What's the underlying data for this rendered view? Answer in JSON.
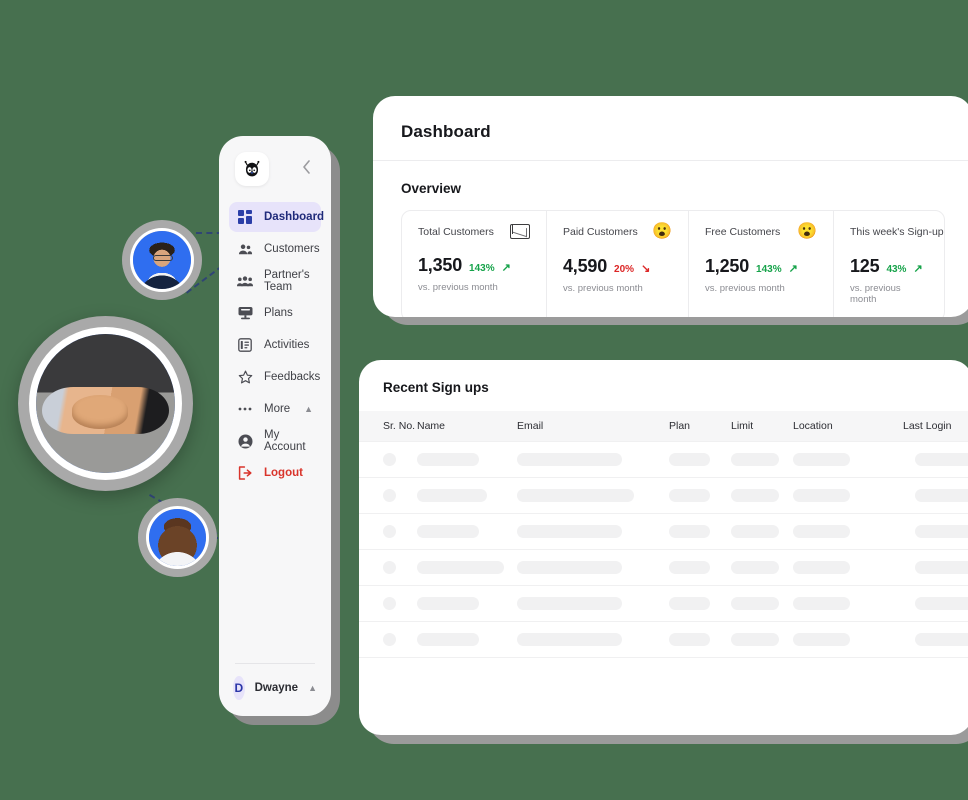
{
  "theme": {
    "background": "#47704f",
    "accent": "#2b3ea8",
    "active_bg": "#e7e3fa",
    "danger": "#d9342b",
    "up": "#16a34a",
    "down": "#dc2626"
  },
  "sidebar": {
    "logo_name": "penguin-mascot-logo",
    "collapse_icon": "chevron-left-icon",
    "items": [
      {
        "label": "Dashboard",
        "icon": "grid-dashboard-icon",
        "active": true
      },
      {
        "label": "Customers",
        "icon": "people-icon",
        "active": false
      },
      {
        "label": "Partner's Team",
        "icon": "group-team-icon",
        "active": false
      },
      {
        "label": "Plans",
        "icon": "monitor-icon",
        "active": false
      },
      {
        "label": "Activities",
        "icon": "list-panel-icon",
        "active": false
      },
      {
        "label": "Feedbacks",
        "icon": "star-icon",
        "active": false
      },
      {
        "label": "More",
        "icon": "ellipsis-icon",
        "active": false,
        "caret": "▲"
      },
      {
        "label": "My Account",
        "icon": "user-circle-icon",
        "active": false
      },
      {
        "label": "Logout",
        "icon": "logout-icon",
        "active": false,
        "danger": true
      }
    ],
    "user": {
      "initial": "D",
      "name": "Dwayne",
      "caret": "▲",
      "avatar_name": "user-avatar-initial"
    }
  },
  "main": {
    "page_title": "Dashboard",
    "overview_title": "Overview",
    "cards": [
      {
        "label": "Total Customers",
        "icon": "envelope-icon",
        "value": "1,350",
        "delta": "143%",
        "direction": "up",
        "arrow": "↗",
        "sub": "vs. previous month"
      },
      {
        "label": "Paid Customers",
        "icon": "astonished-face-emoji",
        "value": "4,590",
        "delta": "20%",
        "direction": "down",
        "arrow": "↘",
        "sub": "vs. previous month"
      },
      {
        "label": "Free Customers",
        "icon": "astonished-face-emoji",
        "value": "1,250",
        "delta": "143%",
        "direction": "up",
        "arrow": "↗",
        "sub": "vs. previous month"
      },
      {
        "label": "This week's Sign-up",
        "icon": "graduate-face-emoji",
        "value": "125",
        "delta": "43%",
        "direction": "up",
        "arrow": "↗",
        "sub": "vs. previous month"
      }
    ],
    "table": {
      "title": "Recent Sign ups",
      "columns": [
        "Sr. No.",
        "Name",
        "Email",
        "Plan",
        "Limit",
        "Location",
        "Last Login"
      ],
      "placeholder_row_count": 6,
      "loading": true
    }
  },
  "illustration": {
    "nodes": [
      {
        "name": "avatar-businessman-photo"
      },
      {
        "name": "handshake-photo"
      },
      {
        "name": "avatar-businesswoman-photo"
      }
    ]
  }
}
